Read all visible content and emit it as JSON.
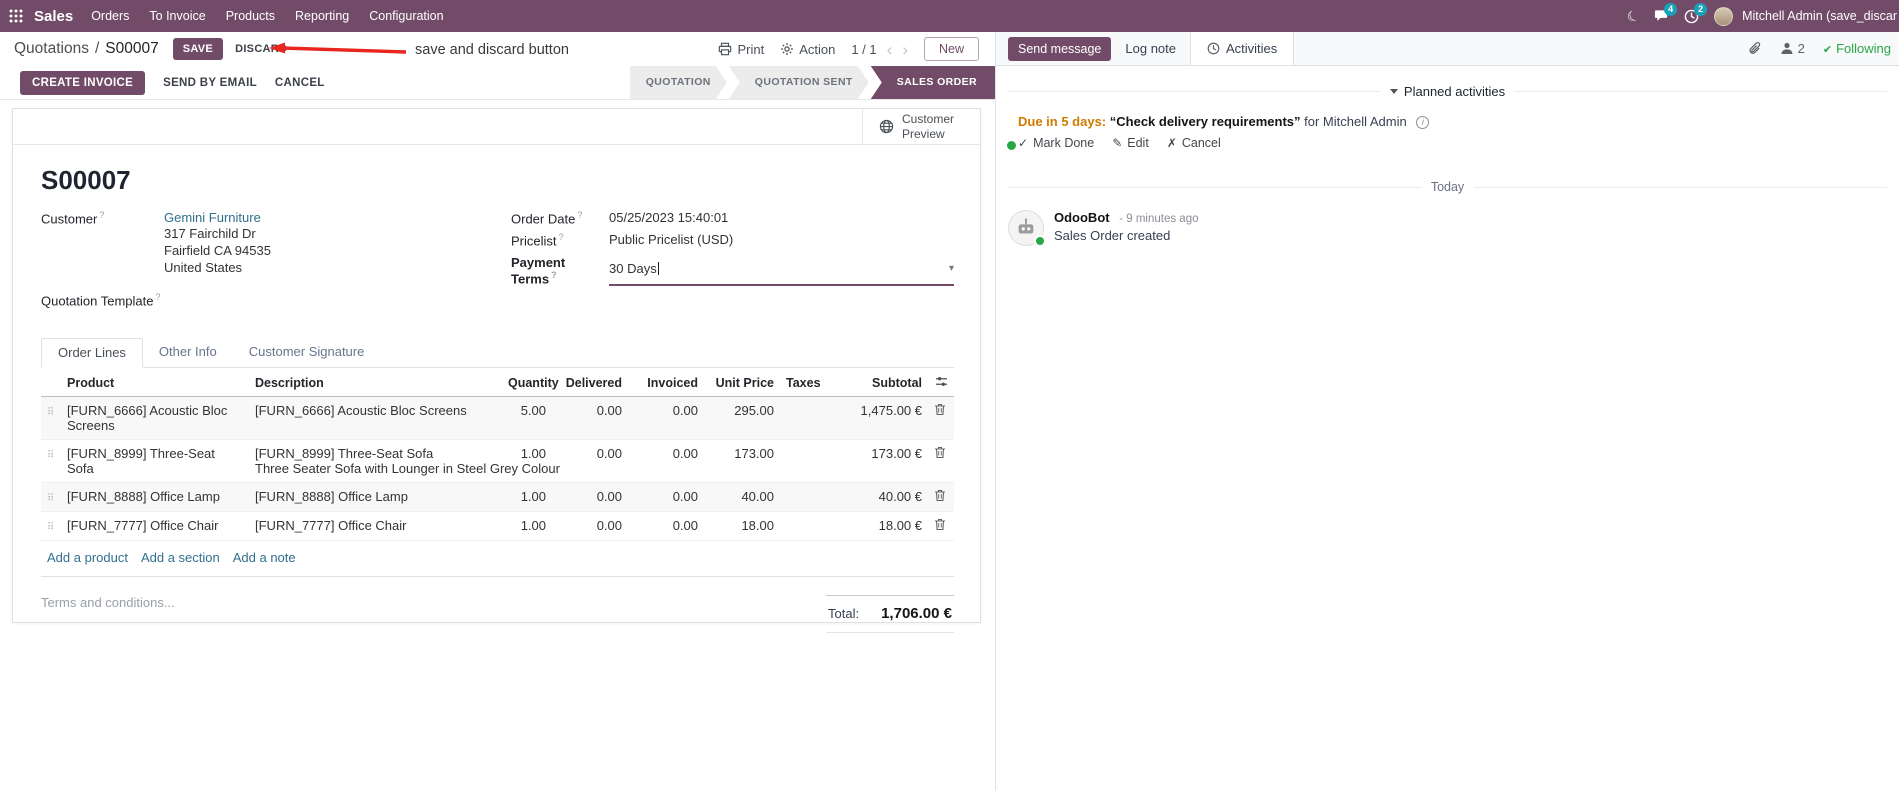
{
  "colors": {
    "primary": "#714B67",
    "link": "#31708f",
    "edited_value_blue": "#2962c4",
    "activity_due_orange": "#d07b00",
    "success_green": "#28a745",
    "annotation_red": "#e8251f",
    "badge_blue": "#17a2b8"
  },
  "icons": {
    "pager_previous": "‹",
    "pager_next": "›",
    "dropdown_caret": "▾",
    "drag_handle": "⠿",
    "check": "✓",
    "edit_pencil": "✎",
    "cancel_x": "✗",
    "following_check": "✔"
  },
  "navbar": {
    "app_name": "Sales",
    "menus": [
      "Orders",
      "To Invoice",
      "Products",
      "Reporting",
      "Configuration"
    ],
    "messages_badge": "4",
    "activities_badge": "2",
    "user_name": "Mitchell Admin (save_discar"
  },
  "control_panel": {
    "breadcrumb_parent": "Quotations",
    "breadcrumb_separator": "/",
    "breadcrumb_current": "S00007",
    "save_label": "SAVE",
    "discard_label": "DISCARD",
    "print_label": "Print",
    "action_label": "Action",
    "pager_value": "1 / 1",
    "new_label": "New"
  },
  "annotation": {
    "text": "save and discard button"
  },
  "status_bar": {
    "create_invoice": "CREATE INVOICE",
    "send_by_email": "SEND BY EMAIL",
    "cancel": "CANCEL",
    "states": [
      "QUOTATION",
      "QUOTATION SENT",
      "SALES ORDER"
    ],
    "active_state": "SALES ORDER"
  },
  "form": {
    "customer_preview": "Customer Preview",
    "title": "S00007",
    "fields": {
      "customer_label": "Customer",
      "customer_name": "Gemini Furniture",
      "customer_address": [
        "317 Fairchild Dr",
        "Fairfield CA 94535",
        "United States"
      ],
      "quotation_template_label": "Quotation Template",
      "order_date_label": "Order Date",
      "order_date_value": "05/25/2023 15:40:01",
      "pricelist_label": "Pricelist",
      "pricelist_value": "Public Pricelist (USD)",
      "payment_terms_label": "Payment Terms",
      "payment_terms_value": "30 Days"
    },
    "tabs": [
      "Order Lines",
      "Other Info",
      "Customer Signature"
    ],
    "active_tab": "Order Lines",
    "order_lines": {
      "columns": [
        "Product",
        "Description",
        "Quantity",
        "Delivered",
        "Invoiced",
        "Unit Price",
        "Taxes",
        "Subtotal"
      ],
      "rows": [
        {
          "product": "[FURN_6666] Acoustic Bloc Screens",
          "description": "[FURN_6666] Acoustic Bloc Screens",
          "description_extra": "",
          "quantity": "5.00",
          "delivered": "0.00",
          "invoiced": "0.00",
          "unit_price": "295.00",
          "taxes": "",
          "subtotal": "1,475.00 €"
        },
        {
          "product": "[FURN_8999] Three-Seat Sofa",
          "description": "[FURN_8999] Three-Seat Sofa",
          "description_extra": "Three Seater Sofa with Lounger in Steel Grey Colour",
          "quantity": "1.00",
          "delivered": "0.00",
          "invoiced": "0.00",
          "unit_price": "173.00",
          "taxes": "",
          "subtotal": "173.00 €"
        },
        {
          "product": "[FURN_8888] Office Lamp",
          "description": "[FURN_8888] Office Lamp",
          "description_extra": "",
          "quantity": "1.00",
          "delivered": "0.00",
          "invoiced": "0.00",
          "unit_price": "40.00",
          "taxes": "",
          "subtotal": "40.00 €"
        },
        {
          "product": "[FURN_7777] Office Chair",
          "description": "[FURN_7777] Office Chair",
          "description_extra": "",
          "quantity": "1.00",
          "delivered": "0.00",
          "invoiced": "0.00",
          "unit_price": "18.00",
          "taxes": "",
          "subtotal": "18.00 €"
        }
      ],
      "add_product": "Add a product",
      "add_section": "Add a section",
      "add_note": "Add a note"
    },
    "terms_placeholder": "Terms and conditions...",
    "total_label": "Total:",
    "total_value": "1,706.00 €"
  },
  "chatter": {
    "send_message": "Send message",
    "log_note": "Log note",
    "activities_tab": "Activities",
    "followers_count": "2",
    "following": "Following",
    "planned_activities_header": "Planned activities",
    "activity": {
      "due": "Due in 5 days:",
      "summary": "“Check delivery requirements”",
      "assignee": "for Mitchell Admin",
      "mark_done": "Mark Done",
      "edit": "Edit",
      "cancel": "Cancel"
    },
    "date_divider": "Today",
    "message": {
      "author": "OdooBot",
      "timestamp": "- 9 minutes ago",
      "body": "Sales Order created"
    }
  }
}
